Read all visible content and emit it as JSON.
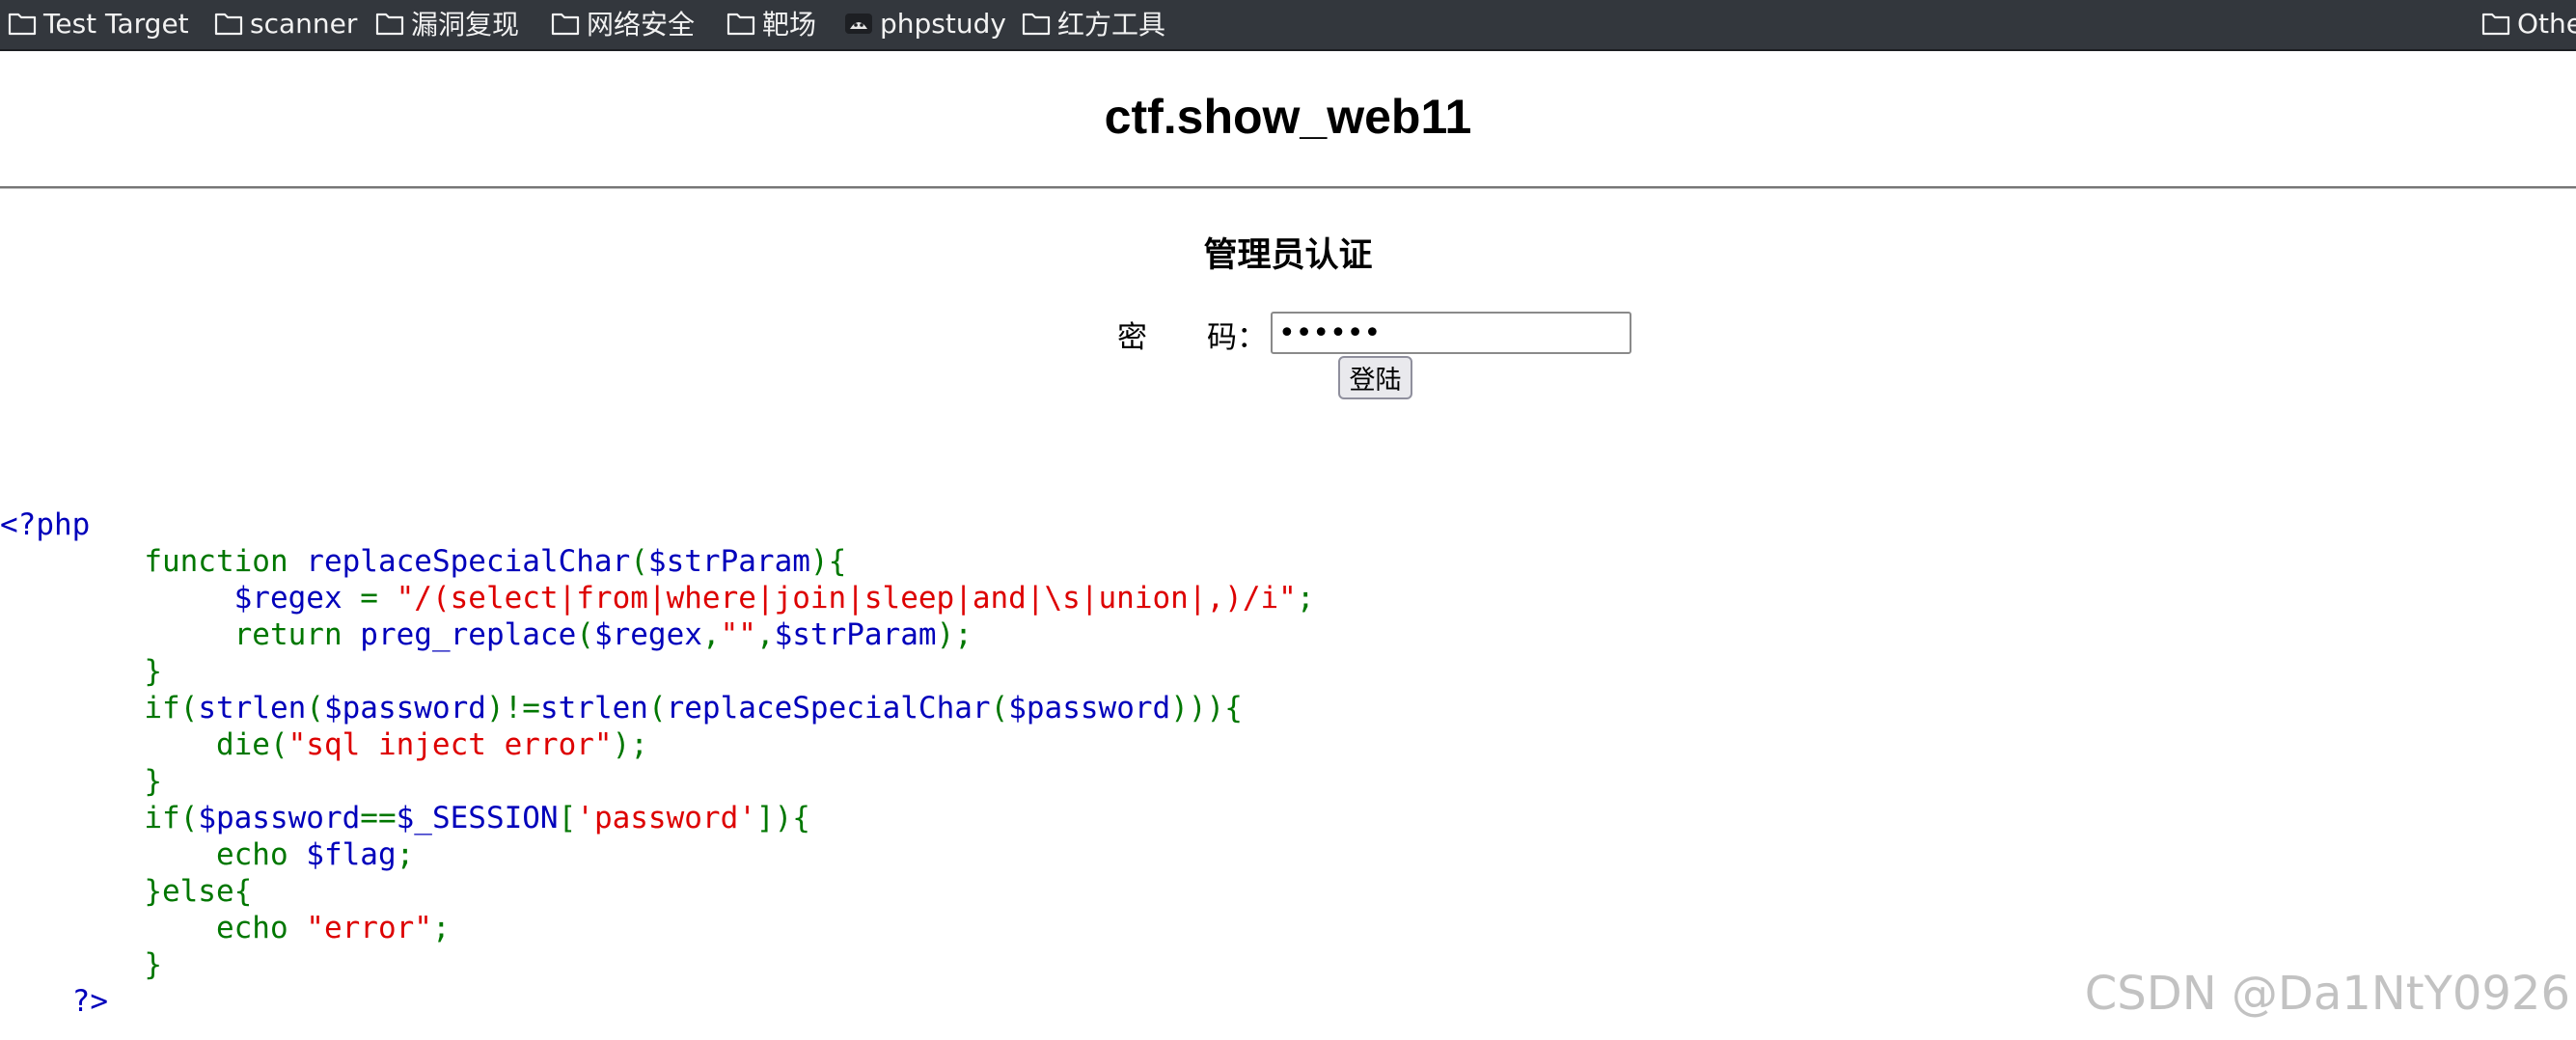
{
  "bookmarks": [
    {
      "label": "Test Target",
      "icon": "folder-icon"
    },
    {
      "label": "scanner",
      "icon": "folder-icon"
    },
    {
      "label": "漏洞复现",
      "icon": "folder-icon"
    },
    {
      "label": "网络安全",
      "icon": "folder-icon"
    },
    {
      "label": "靶场",
      "icon": "folder-icon"
    },
    {
      "label": "phpstudy",
      "icon": "phpstudy-icon"
    },
    {
      "label": "红方工具",
      "icon": "folder-icon"
    },
    {
      "label": "Othe",
      "icon": "folder-icon"
    }
  ],
  "page": {
    "title": "ctf.show_web11",
    "auth_heading": "管理员认证",
    "password_label": "密　　码：",
    "password_value": "••••••",
    "login_button": "登陆"
  },
  "code": {
    "open_tag": "<?php",
    "fn_keyword": "function ",
    "fn_name": "replaceSpecialChar",
    "fn_paren_open": "(",
    "fn_param": "$strParam",
    "fn_paren_close": "){",
    "regex_var": "$regex",
    "regex_eq": " = ",
    "regex_value": "\"/(select|from|where|join|sleep|and|\\s|union|,)/i\"",
    "semicolon": ";",
    "return_keyword": "return ",
    "preg_call": "preg_replace",
    "preg_open": "(",
    "preg_arg1": "$regex",
    "comma": ",",
    "empty_string": "\"\"",
    "preg_arg3": "$strParam",
    "preg_close": ");",
    "close_brace": "}",
    "if1_open": "if(",
    "strlen1": "strlen",
    "paren_open": "(",
    "password_var": "$password",
    "if1_neq": ")!=",
    "strlen2": "strlen",
    "replace_call": "replaceSpecialChar",
    "if1_close": "))){",
    "die_call": "die(",
    "die_msg": "\"sql inject error\"",
    "die_close": ");",
    "if2_open": "if(",
    "if2_eq": "==",
    "session_var": "$_SESSION",
    "bracket_open": "[",
    "session_key": "'password'",
    "bracket_close": "]){",
    "echo_keyword": "echo ",
    "flag_var": "$flag",
    "else_block": "}else{",
    "error_msg": "\"error\"",
    "close_tag": "?>"
  },
  "watermark": "CSDN @Da1NtY0926",
  "colors": {
    "code_default": "#0000bb",
    "code_keyword": "#007700",
    "code_string": "#dd0000",
    "bookmarks_bar": "#33373d"
  }
}
